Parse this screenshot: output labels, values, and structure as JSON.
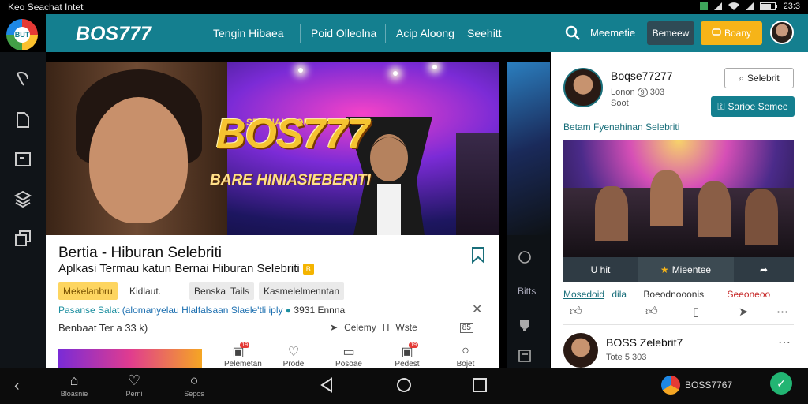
{
  "status_bar": {
    "title": "Keo Seachat Intet",
    "time": "23:3",
    "battery_icon": "battery-icon",
    "wifi_icon": "wifi-icon"
  },
  "header": {
    "logo_text": "BUT",
    "brand": "BOS777",
    "nav": [
      "Tengin Hibaea",
      "Poid Olleolna",
      "Acip Aloong",
      "Seehitt"
    ],
    "search_label": "Meemetie",
    "btn_dark": "Bemeew",
    "btn_yellow": "Boany"
  },
  "sidebar": {
    "icons": [
      "refresh-icon",
      "document-icon",
      "folder-icon",
      "layers-icon",
      "gallery-icon"
    ]
  },
  "hero": {
    "top_badge": "SPECIAL SOMAG",
    "logo": "BOS777",
    "subtitle": "BARE HINIASIEBERITI"
  },
  "card": {
    "title": "Bertia - Hiburan Selebriti",
    "subtitle": "Aplkasi Termau katun Bernai Hiburan Selebriti",
    "subtitle_badge": "B",
    "chips": [
      "Mekelanbru",
      "Kidlaut.",
      "Benskata",
      "Tails",
      "Kasmelelmenntan"
    ],
    "tag_line_prefix": "Pasanse Salat",
    "tag_line_mid": "(alomanyelau Hlalfalsaan",
    "tag_line_link": "Slaele'tli iply",
    "tag_line_num": "3931",
    "tag_line_end": "Ennna",
    "bottom_line": "Benbaat Ter a 33 k)",
    "meta_celemy": "Celemy",
    "meta_h": "H",
    "meta_wste": "Wste",
    "meta_badge": "85",
    "actions": [
      {
        "label": "Pelemetan",
        "icon": "gift-icon",
        "badge": "19"
      },
      {
        "label": "Prode",
        "icon": "heart-icon",
        "badge": ""
      },
      {
        "label": "Posoae",
        "icon": "document-icon",
        "badge": ""
      },
      {
        "label": "Pedest",
        "icon": "gift-icon",
        "badge": "19"
      },
      {
        "label": "Bojet",
        "icon": "comment-icon",
        "badge": ""
      }
    ]
  },
  "mid_strip": {
    "label": "Bitts"
  },
  "right_panel": {
    "name": "Boqse77277",
    "meta_line1": "Lonon",
    "meta_num": "9",
    "meta_line1_end": "303",
    "meta_line2": "Soot",
    "btn_outline": "Selebrit",
    "btn_teal": "Sarioe Semee",
    "section": "Betam Fyenahinan Selebriti",
    "bar_left": "U hit",
    "bar_mid": "Mieentee",
    "links": [
      "Mosedoid",
      "dila",
      "Boeodnooonis",
      "Seeoneoo"
    ],
    "name2": "BOSS Zelebrit7",
    "meta2": "Tote 5 303"
  },
  "navbar": {
    "items": [
      {
        "label": "Bloasnie",
        "icon": "home-icon"
      },
      {
        "label": "Perni",
        "icon": "heart-icon"
      },
      {
        "label": "Sepos",
        "icon": "circle-icon"
      }
    ],
    "brand": "BOSS7767"
  },
  "colors": {
    "header_teal": "#147f8f",
    "accent_yellow": "#f6b418",
    "dark_button": "#2f4a55"
  }
}
